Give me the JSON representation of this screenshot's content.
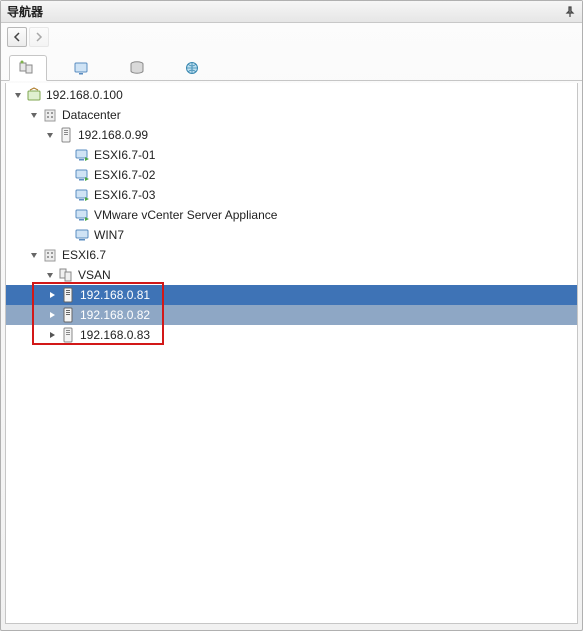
{
  "header": {
    "title": "导航器"
  },
  "tree": {
    "root_label": "192.168.0.100",
    "datacenter_label": "Datacenter",
    "host99_label": "192.168.0.99",
    "vm1_label": "ESXI6.7-01",
    "vm2_label": "ESXI6.7-02",
    "vm3_label": "ESXI6.7-03",
    "vm4_label": "VMware vCenter Server Appliance",
    "vm5_label": "WIN7",
    "cluster_label": "ESXI6.7",
    "vsan_label": "VSAN",
    "host81_label": "192.168.0.81",
    "host82_label": "192.168.0.82",
    "host83_label": "192.168.0.83"
  }
}
